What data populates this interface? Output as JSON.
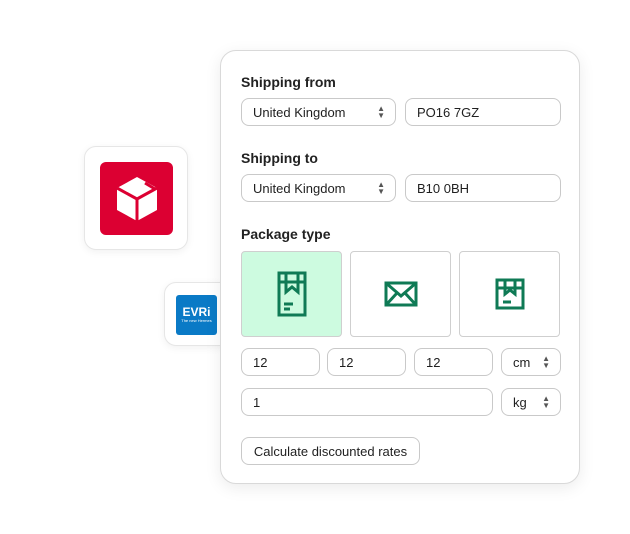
{
  "carriers": [
    {
      "name": "DPD",
      "color": "#dc0032"
    },
    {
      "name": "EVRi",
      "tagline": "The new Hermes",
      "color": "#0a7ac6"
    }
  ],
  "form": {
    "shipping_from": {
      "label": "Shipping from",
      "country": "United Kingdom",
      "postcode": "PO16 7GZ"
    },
    "shipping_to": {
      "label": "Shipping to",
      "country": "United Kingdom",
      "postcode": "B10 0BH"
    },
    "package_type": {
      "label": "Package type",
      "options": [
        {
          "icon": "box-bag-icon",
          "selected": true
        },
        {
          "icon": "envelope-icon",
          "selected": false
        },
        {
          "icon": "parcel-box-icon",
          "selected": false
        }
      ]
    },
    "dimensions": {
      "length": "12",
      "width": "12",
      "height": "12",
      "unit": "cm"
    },
    "weight": {
      "value": "1",
      "unit": "kg"
    },
    "submit_label": "Calculate discounted rates"
  },
  "colors": {
    "accent": "#0f7a55",
    "selected_bg": "#cdfbe0"
  }
}
